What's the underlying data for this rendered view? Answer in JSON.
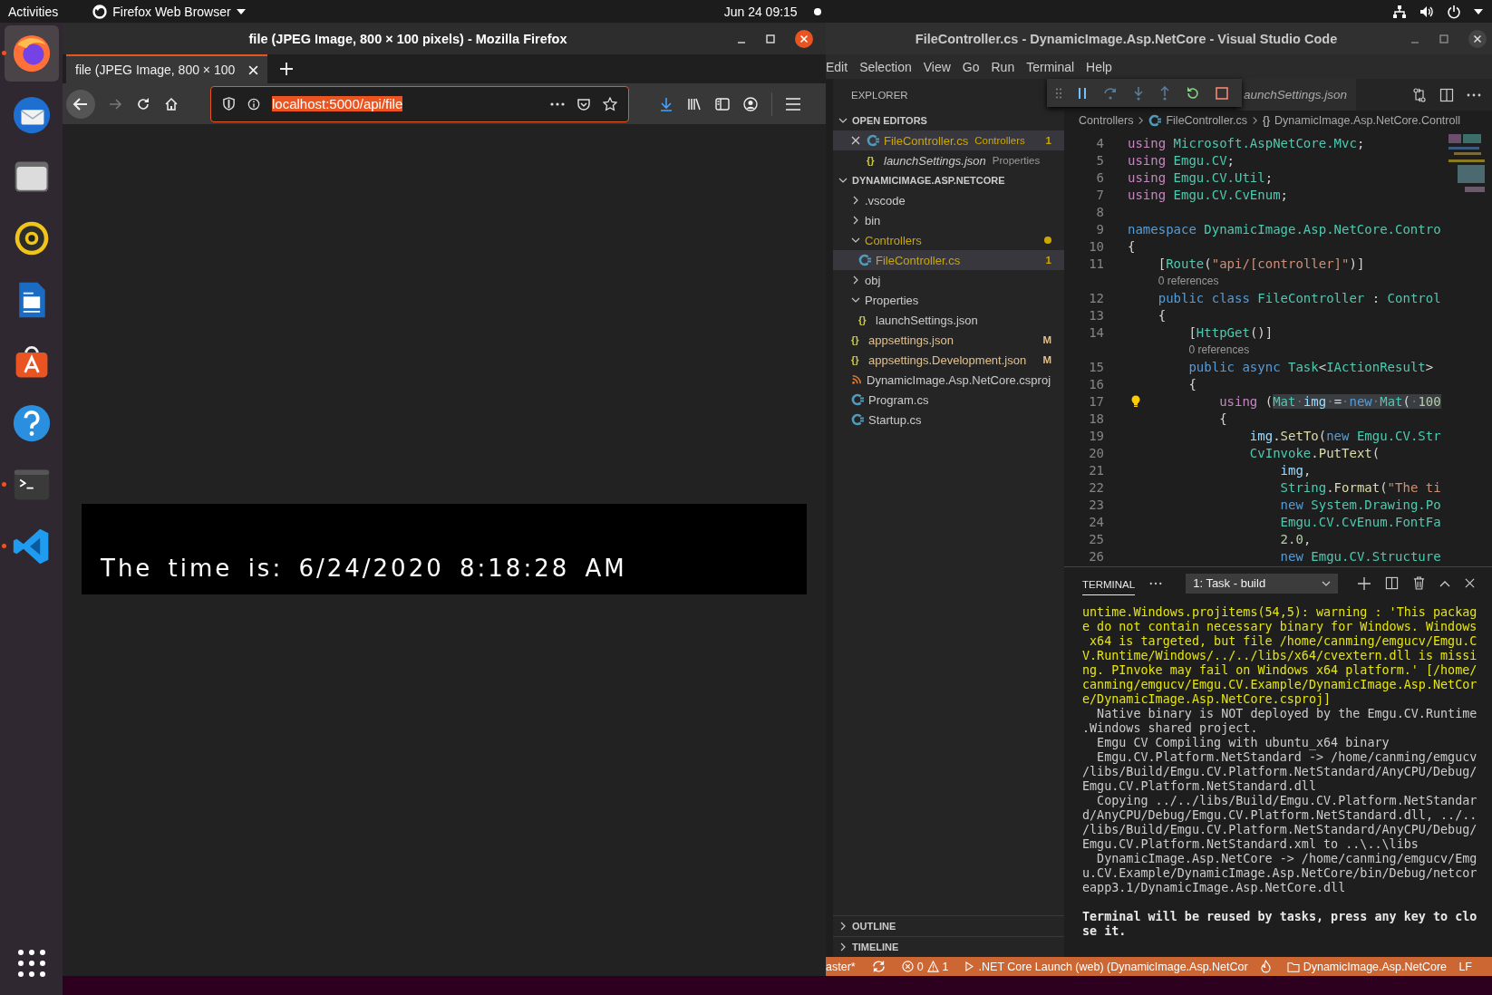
{
  "top_bar": {
    "activities": "Activities",
    "app_menu": "Firefox Web Browser",
    "clock": "Jun 24  09:15"
  },
  "dock": {
    "apps": [
      {
        "kind": "firefox",
        "selected": true,
        "running": true
      },
      {
        "kind": "mail",
        "selected": false,
        "running": false
      },
      {
        "kind": "files",
        "selected": false,
        "running": false
      },
      {
        "kind": "music",
        "selected": false,
        "running": false
      },
      {
        "kind": "writer",
        "selected": false,
        "running": false
      },
      {
        "kind": "software",
        "selected": false,
        "running": false
      },
      {
        "kind": "help",
        "selected": false,
        "running": false
      },
      {
        "kind": "terminal",
        "selected": false,
        "running": true
      },
      {
        "kind": "vscode",
        "selected": false,
        "running": true
      }
    ]
  },
  "firefox": {
    "title": "file (JPEG Image, 800 × 100 pixels) - Mozilla Firefox",
    "tab": "file (JPEG Image, 800 × 100",
    "url": {
      "value": "localhost:5000/api/file",
      "selected": true
    },
    "image_text": "The time is: 6/24/2020 8:18:28 AM"
  },
  "vscode": {
    "title": "FileController.cs - DynamicImage.Asp.NetCore - Visual Studio Code",
    "menu": [
      "Edit",
      "Selection",
      "View",
      "Go",
      "Run",
      "Terminal",
      "Help"
    ],
    "explorer": {
      "title": "EXPLORER",
      "open_editors": {
        "title": "OPEN EDITORS",
        "expanded": true,
        "items": [
          {
            "name": "FileController.cs",
            "folder": "Controllers",
            "kind": "csharp",
            "color": "#cca700",
            "badge": "1",
            "italic": false,
            "selected": true
          },
          {
            "name": "launchSettings.json",
            "folder": "Properties",
            "kind": "json",
            "icon": "{}",
            "italic": true,
            "selected": false
          }
        ]
      },
      "project": {
        "title": "DYNAMICIMAGE.ASP.NETCORE",
        "expanded": true,
        "tree": [
          {
            "name": ".vscode",
            "kind": "folder",
            "expanded": false,
            "selected": false
          },
          {
            "name": "bin",
            "kind": "folder",
            "expanded": false,
            "selected": false
          },
          {
            "name": "Controllers",
            "kind": "folder",
            "expanded": true,
            "color": "#cca700",
            "selected": false,
            "children": [
              {
                "name": "FileController.cs",
                "kind": "csharp",
                "color": "#cca700",
                "badge": "1",
                "selected": true
              }
            ]
          },
          {
            "name": "obj",
            "kind": "folder",
            "expanded": false,
            "selected": false
          },
          {
            "name": "Properties",
            "kind": "folder",
            "expanded": true,
            "selected": false,
            "children": [
              {
                "name": "launchSettings.json",
                "kind": "json",
                "icon": "{}",
                "selected": false
              }
            ]
          },
          {
            "name": "appsettings.json",
            "kind": "json",
            "icon": "{}",
            "color": "#e2c08d",
            "badge": "M",
            "selected": false
          },
          {
            "name": "appsettings.Development.json",
            "kind": "json",
            "icon": "{}",
            "color": "#e2c08d",
            "badge": "M",
            "selected": false
          },
          {
            "name": "DynamicImage.Asp.NetCore.csproj",
            "kind": "project",
            "selected": false
          },
          {
            "name": "Program.cs",
            "kind": "csharp",
            "selected": false
          },
          {
            "name": "Startup.cs",
            "kind": "csharp",
            "selected": false
          }
        ]
      },
      "sections": [
        {
          "title": "OUTLINE",
          "expanded": false
        },
        {
          "title": "TIMELINE",
          "expanded": false
        }
      ]
    },
    "editor": {
      "tab": "aunchSettings.json",
      "breadcrumb": [
        {
          "kind": "folder",
          "text": "Controllers"
        },
        {
          "kind": "csharp",
          "text": "FileController.cs"
        },
        {
          "kind": "namespace",
          "icon": "{}",
          "text": "DynamicImage.Asp.NetCore.Controll"
        }
      ],
      "lines": [
        {
          "kind": "code",
          "number": "4",
          "lightbulb": false,
          "tokens": [
            {
              "kind": "kw",
              "text": "using"
            },
            {
              "kind": "type",
              "text": " Microsoft.AspNetCore.Mvc"
            },
            {
              "kind": "plain",
              "text": ";"
            }
          ]
        },
        {
          "kind": "code",
          "number": "5",
          "lightbulb": false,
          "tokens": [
            {
              "kind": "kw",
              "text": "using"
            },
            {
              "kind": "type",
              "text": " Emgu.CV"
            },
            {
              "kind": "plain",
              "text": ";"
            }
          ]
        },
        {
          "kind": "code",
          "number": "6",
          "lightbulb": false,
          "tokens": [
            {
              "kind": "kw",
              "text": "using"
            },
            {
              "kind": "type",
              "text": " Emgu.CV.Util"
            },
            {
              "kind": "plain",
              "text": ";"
            }
          ]
        },
        {
          "kind": "code",
          "number": "7",
          "lightbulb": false,
          "tokens": [
            {
              "kind": "kw",
              "text": "using"
            },
            {
              "kind": "type",
              "text": " Emgu.CV.CvEnum"
            },
            {
              "kind": "plain",
              "text": ";"
            }
          ]
        },
        {
          "kind": "code",
          "number": "8",
          "lightbulb": false
        },
        {
          "kind": "code",
          "number": "9",
          "lightbulb": false,
          "tokens": [
            {
              "kind": "kw2",
              "text": "namespace"
            },
            {
              "kind": "type",
              "text": " DynamicImage.Asp.NetCore.Contro"
            }
          ]
        },
        {
          "kind": "code",
          "number": "10",
          "lightbulb": false,
          "tokens": [
            {
              "kind": "plain",
              "text": "{"
            }
          ]
        },
        {
          "kind": "code",
          "number": "11",
          "lightbulb": false,
          "tokens": [
            {
              "kind": "plain",
              "text": "    ["
            },
            {
              "kind": "type",
              "text": "Route"
            },
            {
              "kind": "plain",
              "text": "("
            },
            {
              "kind": "str",
              "text": "\"api/[controller]\""
            },
            {
              "kind": "plain",
              "text": ")]"
            }
          ]
        },
        {
          "kind": "lens",
          "text": "0 references"
        },
        {
          "kind": "code",
          "number": "12",
          "lightbulb": false,
          "tokens": [
            {
              "kind": "kw2",
              "text": "    public class"
            },
            {
              "kind": "type",
              "text": " FileController"
            },
            {
              "kind": "plain",
              "text": " : "
            },
            {
              "kind": "type",
              "text": "Control"
            }
          ]
        },
        {
          "kind": "code",
          "number": "13",
          "lightbulb": false,
          "tokens": [
            {
              "kind": "plain",
              "text": "    {"
            }
          ]
        },
        {
          "kind": "code",
          "number": "14",
          "lightbulb": false,
          "tokens": [
            {
              "kind": "plain",
              "text": "        ["
            },
            {
              "kind": "type",
              "text": "HttpGet"
            },
            {
              "kind": "plain",
              "text": "()]"
            }
          ]
        },
        {
          "kind": "lens",
          "text": "0 references"
        },
        {
          "kind": "code",
          "number": "15",
          "lightbulb": false,
          "tokens": [
            {
              "kind": "kw2",
              "text": "        public async"
            },
            {
              "kind": "type",
              "text": " Task"
            },
            {
              "kind": "plain",
              "text": "<"
            },
            {
              "kind": "type",
              "text": "IActionResult"
            },
            {
              "kind": "plain",
              "text": ">"
            }
          ]
        },
        {
          "kind": "code",
          "number": "16",
          "lightbulb": false,
          "tokens": [
            {
              "kind": "plain",
              "text": "        {"
            }
          ]
        },
        {
          "kind": "code",
          "number": "17",
          "lightbulb": true,
          "tokens": [
            {
              "kind": "kw",
              "text": "            using"
            },
            {
              "kind": "plain",
              "text": " ("
            },
            {
              "kind": "selection",
              "tokens": [
                {
                  "kind": "type",
                  "text": "Mat"
                },
                {
                  "kind": "ws",
                  "text": "·"
                },
                {
                  "kind": "var",
                  "text": "img"
                },
                {
                  "kind": "ws",
                  "text": "·"
                },
                {
                  "kind": "plain",
                  "text": "="
                },
                {
                  "kind": "ws",
                  "text": "·"
                },
                {
                  "kind": "kw2",
                  "text": "new"
                },
                {
                  "kind": "ws",
                  "text": "·"
                },
                {
                  "kind": "type",
                  "text": "Mat"
                },
                {
                  "kind": "plain",
                  "text": "("
                },
                {
                  "kind": "ws",
                  "text": "·"
                },
                {
                  "kind": "num",
                  "text": "100"
                }
              ]
            }
          ]
        },
        {
          "kind": "code",
          "number": "18",
          "lightbulb": false,
          "tokens": [
            {
              "kind": "plain",
              "text": "            {"
            }
          ]
        },
        {
          "kind": "code",
          "number": "19",
          "lightbulb": false,
          "tokens": [
            {
              "kind": "var",
              "text": "                img"
            },
            {
              "kind": "plain",
              "text": "."
            },
            {
              "kind": "fn",
              "text": "SetTo"
            },
            {
              "kind": "plain",
              "text": "("
            },
            {
              "kind": "kw2",
              "text": "new"
            },
            {
              "kind": "type",
              "text": " Emgu.CV.Str"
            }
          ]
        },
        {
          "kind": "code",
          "number": "20",
          "lightbulb": false,
          "tokens": [
            {
              "kind": "type",
              "text": "                CvInvoke"
            },
            {
              "kind": "plain",
              "text": "."
            },
            {
              "kind": "fn",
              "text": "PutText"
            },
            {
              "kind": "plain",
              "text": "("
            }
          ]
        },
        {
          "kind": "code",
          "number": "21",
          "lightbulb": false,
          "tokens": [
            {
              "kind": "var",
              "text": "                    img"
            },
            {
              "kind": "plain",
              "text": ","
            }
          ]
        },
        {
          "kind": "code",
          "number": "22",
          "lightbulb": false,
          "tokens": [
            {
              "kind": "type",
              "text": "                    String"
            },
            {
              "kind": "plain",
              "text": "."
            },
            {
              "kind": "fn",
              "text": "Format"
            },
            {
              "kind": "plain",
              "text": "("
            },
            {
              "kind": "str",
              "text": "\"The ti"
            }
          ]
        },
        {
          "kind": "code",
          "number": "23",
          "lightbulb": false,
          "tokens": [
            {
              "kind": "kw2",
              "text": "                    new"
            },
            {
              "kind": "type",
              "text": " System.Drawing.Po"
            }
          ]
        },
        {
          "kind": "code",
          "number": "24",
          "lightbulb": false,
          "tokens": [
            {
              "kind": "type",
              "text": "                    Emgu.CV.CvEnum.FontFa"
            }
          ]
        },
        {
          "kind": "code",
          "number": "25",
          "lightbulb": false,
          "tokens": [
            {
              "kind": "num",
              "text": "                    2.0"
            },
            {
              "kind": "plain",
              "text": ","
            }
          ]
        },
        {
          "kind": "code",
          "number": "26",
          "lightbulb": false,
          "tokens": [
            {
              "kind": "kw2",
              "text": "                    new"
            },
            {
              "kind": "type",
              "text": " Emgu.CV.Structure"
            }
          ]
        }
      ]
    },
    "panel": {
      "tab": {
        "label": "TERMINAL",
        "selected": true
      },
      "task": "1: Task - build",
      "lines": [
        {
          "kind": "warning",
          "text": "untime.Windows.projitems(54,5): warning : 'This packag"
        },
        {
          "kind": "warning",
          "text": "e do not contain necessary binary for Windows. Windows"
        },
        {
          "kind": "warning",
          "text": " x64 is targeted, but file /home/canming/emgucv/Emgu.C"
        },
        {
          "kind": "warning",
          "text": "V.Runtime/Windows/../../libs/x64/cvextern.dll is missi"
        },
        {
          "kind": "warning",
          "text": "ng. PInvoke may fail on Windows x64 platform.' [/home/"
        },
        {
          "kind": "warning",
          "text": "canming/emgucv/Emgu.CV.Example/DynamicImage.Asp.NetCor"
        },
        {
          "kind": "warning",
          "text": "e/DynamicImage.Asp.NetCore.csproj]"
        },
        {
          "kind": "normal",
          "text": "  Native binary is NOT deployed by the Emgu.CV.Runtime"
        },
        {
          "kind": "normal",
          "text": ".Windows shared project."
        },
        {
          "kind": "normal",
          "text": "  Emgu CV Compiling with ubuntu_x64 binary"
        },
        {
          "kind": "normal",
          "text": "  Emgu.CV.Platform.NetStandard -> /home/canming/emgucv"
        },
        {
          "kind": "normal",
          "text": "/libs/Build/Emgu.CV.Platform.NetStandard/AnyCPU/Debug/"
        },
        {
          "kind": "normal",
          "text": "Emgu.CV.Platform.NetStandard.dll"
        },
        {
          "kind": "normal",
          "text": "  Copying ../../libs/Build/Emgu.CV.Platform.NetStandar"
        },
        {
          "kind": "normal",
          "text": "d/AnyCPU/Debug/Emgu.CV.Platform.NetStandard.dll, ../.."
        },
        {
          "kind": "normal",
          "text": "/libs/Build/Emgu.CV.Platform.NetStandard/AnyCPU/Debug/"
        },
        {
          "kind": "normal",
          "text": "Emgu.CV.Platform.NetStandard.xml to ..\\..\\libs"
        },
        {
          "kind": "normal",
          "text": "  DynamicImage.Asp.NetCore -> /home/canming/emgucv/Emg"
        },
        {
          "kind": "normal",
          "text": "u.CV.Example/DynamicImage.Asp.NetCore/bin/Debug/netcor"
        },
        {
          "kind": "normal",
          "text": "eapp3.1/DynamicImage.Asp.NetCore.dll"
        },
        {
          "kind": "blank"
        },
        {
          "kind": "bold",
          "text": "Terminal will be reused by tasks, press any key to clo"
        },
        {
          "kind": "bold",
          "text": "se it."
        }
      ]
    },
    "status_bar": [
      {
        "kind": "branch",
        "text": "aster*"
      },
      {
        "kind": "sync"
      },
      {
        "kind": "problems",
        "errors": "0",
        "warnings": "1"
      },
      {
        "kind": "launch",
        "text": ".NET Core Launch (web) (DynamicImage.Asp.NetCor"
      },
      {
        "kind": "flame"
      },
      {
        "kind": "folder",
        "text": "DynamicImage.Asp.NetCore"
      },
      {
        "kind": "eol",
        "text": "LF"
      }
    ]
  }
}
